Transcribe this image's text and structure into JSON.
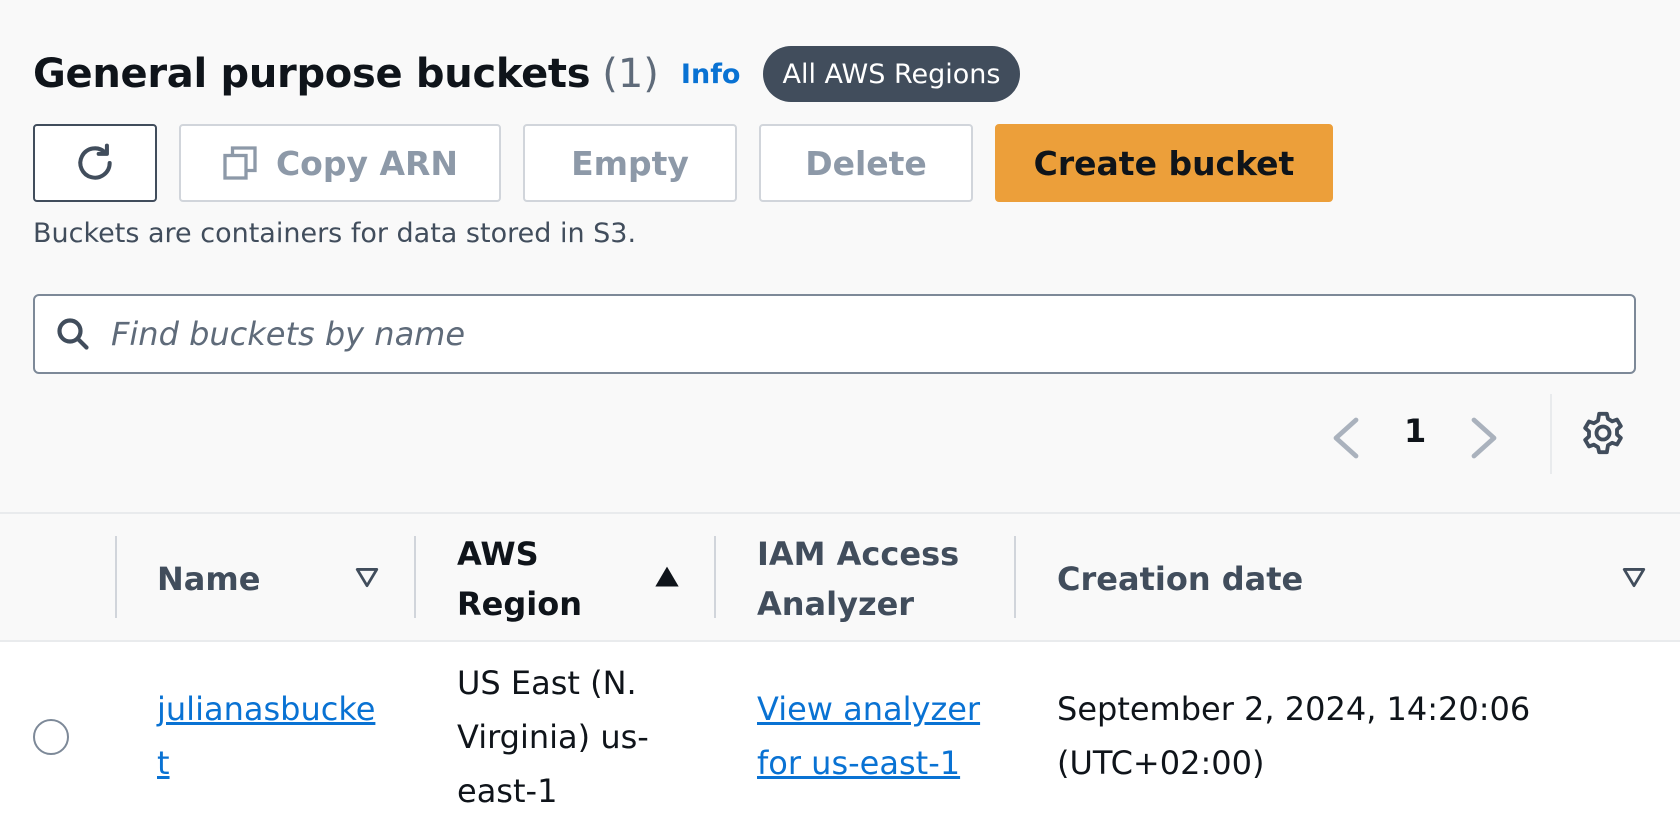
{
  "header": {
    "title": "General purpose buckets",
    "count": "(1)",
    "info_label": "Info",
    "region_badge": "All AWS Regions"
  },
  "toolbar": {
    "refresh_icon": "refresh-icon",
    "copy_icon": "copy-icon",
    "copy_arn_label": "Copy ARN",
    "empty_label": "Empty",
    "delete_label": "Delete",
    "create_label": "Create bucket"
  },
  "description": "Buckets are containers for data stored in S3.",
  "search": {
    "placeholder": "Find buckets by name",
    "icon": "search-icon"
  },
  "pagination": {
    "current_page": "1",
    "prev_icon": "chevron-left-icon",
    "next_icon": "chevron-right-icon",
    "settings_icon": "gear-icon"
  },
  "table": {
    "columns": [
      {
        "label": "Name",
        "sort": "none"
      },
      {
        "label": "AWS Region",
        "sort": "ascending"
      },
      {
        "label": "IAM Access Analyzer",
        "sort": "none"
      },
      {
        "label": "Creation date",
        "sort": "none"
      }
    ],
    "rows": [
      {
        "selected": false,
        "name": "julianasbucket",
        "region": "US East (N. Virginia) us-east-1",
        "iam": "View analyzer for us-east-1",
        "created": "September 2, 2024, 14:20:06 (UTC+02:00)"
      }
    ]
  },
  "colors": {
    "primary": "#ec9f3a",
    "link": "#0972d3",
    "badge": "#414d5c",
    "background": "#f9f9f9"
  }
}
